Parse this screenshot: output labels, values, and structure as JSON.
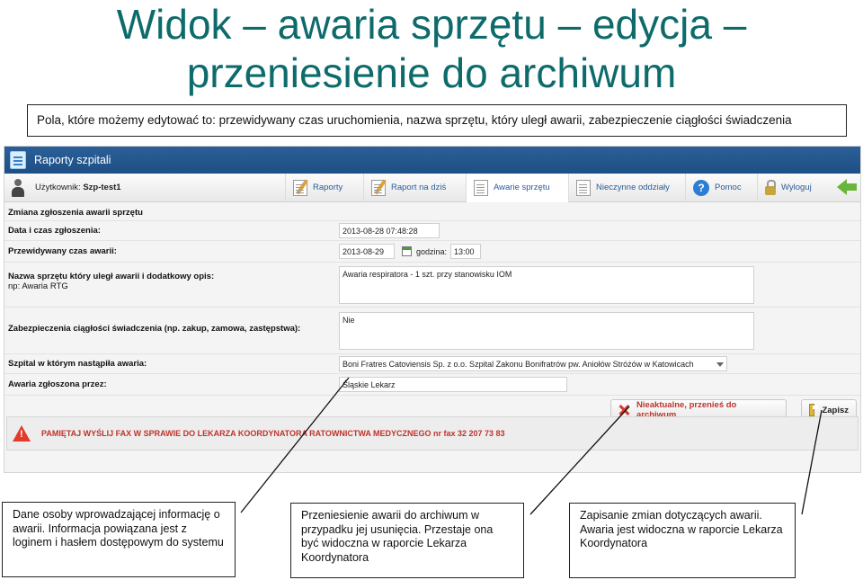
{
  "slide": {
    "title_line1": "Widok – awaria sprzętu – edycja –",
    "title_line2": "przeniesienie do archiwum",
    "note": "Pola, które możemy edytować to: przewidywany czas uruchomienia, nazwa sprzętu, który uległ awarii, zabezpieczenie ciągłości świadczenia"
  },
  "app": {
    "title": "Raporty szpitali",
    "user_label": "Użytkownik:",
    "user_name": "Szp-test1",
    "nav": [
      {
        "label": "Raporty",
        "icon": "pen-doc-icon"
      },
      {
        "label": "Raport na dziś",
        "icon": "pen-doc-icon"
      },
      {
        "label": "Awarie sprzętu",
        "icon": "document-icon"
      },
      {
        "label": "Nieczynne oddziały",
        "icon": "document-icon"
      },
      {
        "label": "Pomoc",
        "icon": "help-icon"
      },
      {
        "label": "Wyloguj",
        "icon": "lock-icon"
      }
    ],
    "form": {
      "title": "Zmiana zgłoszenia awarii sprzętu",
      "report_datetime_label": "Data i czas zgłoszenia:",
      "report_datetime_value": "2013-08-28 07:48:28",
      "expected_time_label": "Przewidywany czas awarii:",
      "expected_date_value": "2013-08-29",
      "time_label": "godzina:",
      "time_value": "13:00",
      "equipment_label": "Nazwa sprzętu który uległ awarii i dodatkowy opis:",
      "equipment_hint": "np: Awaria RTG",
      "equipment_value": "Awaria respiratora - 1 szt. przy stanowisku IOM",
      "continuity_label": "Zabezpieczenia ciągłości świadczenia (np. zakup, zamowa, zastępstwa):",
      "continuity_value": "Nie",
      "hospital_label": "Szpital w którym nastąpiła awaria:",
      "hospital_value": "Boni Fratres Catoviensis Sp. z o.o. Szpital Zakonu Bonifratrów pw. Aniołów Stróżów w Katowicach",
      "reporter_label": "Awaria zgłoszona przez:",
      "reporter_value": "Śląskie Lekarz"
    },
    "buttons": {
      "archive": "Nieaktualne, przenieś do archiwum",
      "save": "Zapisz"
    },
    "warning": "PAMIĘTAJ WYŚLIJ FAX W SPRAWIE DO LEKARZA KOORDYNATORA RATOWNICTWA MEDYCZNEGO nr fax 32 207 73 83"
  },
  "callouts": [
    "Dane osoby wprowadzającej informację o awarii. Informacja powiązana jest z loginem i hasłem dostępowym do systemu",
    "Przeniesienie awarii do archiwum w przypadku jej usunięcia. Przestaje ona być widoczna w raporcie Lekarza Koordynatora",
    "Zapisanie zmian dotyczących awarii. Awaria jest widoczna w raporcie Lekarza Koordynatora"
  ],
  "colors": {
    "title": "#0e6b6b",
    "header": "#1e4f86",
    "nav_text": "#2a5d99",
    "alert": "#c0322a"
  }
}
